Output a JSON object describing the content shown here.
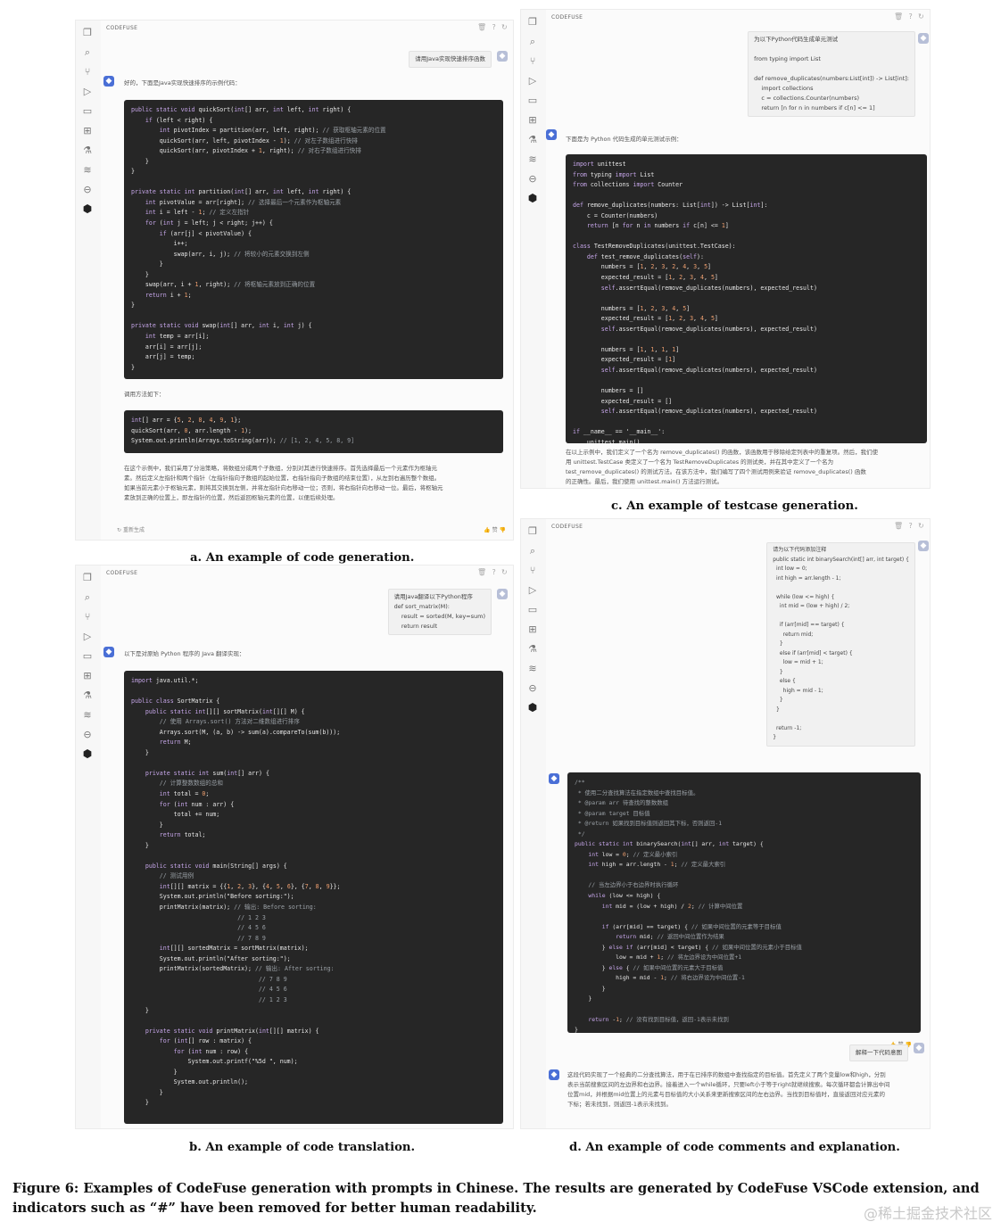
{
  "brand": "CODEFUSE",
  "icons": [
    "copy-icon",
    "search-icon",
    "source-control-icon",
    "run-debug-icon",
    "remote-icon",
    "extensions-icon",
    "flask-icon",
    "docker-icon",
    "minus-circle-icon",
    "codefuse-icon"
  ],
  "panel_a": {
    "prompt": "请用Java实现快速排序函数",
    "intro": "好的，下面是Java实现快速排序的示例代码：",
    "code": [
      "public static void quickSort(int[] arr, int left, int right) {",
      "    if (left < right) {",
      "        int pivotIndex = partition(arr, left, right); // 获取枢轴元素的位置",
      "        quickSort(arr, left, pivotIndex - 1); // 对左子数组进行快排",
      "        quickSort(arr, pivotIndex + 1, right); // 对右子数组进行快排",
      "    }",
      "}",
      "",
      "private static int partition(int[] arr, int left, int right) {",
      "    int pivotValue = arr[right]; // 选择最后一个元素作为枢轴元素",
      "    int i = left - 1; // 定义左指针",
      "    for (int j = left; j < right; j++) {",
      "        if (arr[j] < pivotValue) {",
      "            i++;",
      "            swap(arr, i, j); // 将较小的元素交换到左侧",
      "        }",
      "    }",
      "    swap(arr, i + 1, right); // 将枢轴元素放到正确的位置",
      "    return i + 1;",
      "}",
      "",
      "private static void swap(int[] arr, int i, int j) {",
      "    int temp = arr[i];",
      "    arr[i] = arr[j];",
      "    arr[j] = temp;",
      "}"
    ],
    "usage_label": "调用方法如下：",
    "usage_code": [
      "int[] arr = {5, 2, 8, 4, 9, 1};",
      "quickSort(arr, 0, arr.length - 1);",
      "System.out.println(Arrays.toString(arr)); // [1, 2, 4, 5, 8, 9]"
    ],
    "explain": [
      "在这个示例中，我们采用了分治策略，将数组分成两个子数组，分别对其进行快速排序。首先选择最后一个元素作为枢轴元",
      "素。然后定义左指针和两个指针（左指针指向子数组的起始位置，右指针指向子数组的结束位置），从左到右遍历整个数组。",
      "如果当前元素小于枢轴元素，则将其交换到左侧，并将左指针向右移动一位；否则，将右指针向右移动一位。最后，将枢轴元",
      "素放到正确的位置上，即左指针的位置，然后返回枢轴元素的位置，以便后续处理。"
    ],
    "regenerate": "重新生成",
    "like": "赞",
    "caption": "a. An example of code generation."
  },
  "panel_b": {
    "prompt": "请用Java翻译以下Python程序\ndef sort_matrix(M):\n    result = sorted(M, key=sum)\n    return result",
    "intro": "以下是对原始 Python 程序的 Java 翻译实现：",
    "code": [
      "import java.util.*;",
      "",
      "public class SortMatrix {",
      "    public static int[][] sortMatrix(int[][] M) {",
      "        // 使用 Arrays.sort() 方法对二维数组进行排序",
      "        Arrays.sort(M, (a, b) -> sum(a).compareTo(sum(b)));",
      "        return M;",
      "    }",
      "",
      "    private static int sum(int[] arr) {",
      "        // 计算整数数组的总和",
      "        int total = 0;",
      "        for (int num : arr) {",
      "            total += num;",
      "        }",
      "        return total;",
      "    }",
      "",
      "    public static void main(String[] args) {",
      "        // 测试用例",
      "        int[][] matrix = {{1, 2, 3}, {4, 5, 6}, {7, 8, 9}};",
      "        System.out.println(\"Before sorting:\");",
      "        printMatrix(matrix); // 输出: Before sorting:",
      "                              // 1 2 3",
      "                              // 4 5 6",
      "                              // 7 8 9",
      "        int[][] sortedMatrix = sortMatrix(matrix);",
      "        System.out.println(\"After sorting:\");",
      "        printMatrix(sortedMatrix); // 输出: After sorting:",
      "                                    // 7 8 9",
      "                                    // 4 5 6",
      "                                    // 1 2 3",
      "    }",
      "",
      "    private static void printMatrix(int[][] matrix) {",
      "        for (int[] row : matrix) {",
      "            for (int num : row) {",
      "                System.out.printf(\"%5d \", num);",
      "            }",
      "            System.out.println();",
      "        }",
      "    }"
    ],
    "caption": "b. An example of code translation."
  },
  "panel_c": {
    "prompt": "为以下Python代码生成单元测试\n\nfrom typing import List\n\ndef remove_duplicates(numbers:List[int]) -> List[int]:\n    import collections\n    c = collections.Counter(numbers)\n    return [n for n in numbers if c[n] <= 1]",
    "intro": "下面是为 Python 代码生成的单元测试示例：",
    "code": [
      "import unittest",
      "from typing import List",
      "from collections import Counter",
      "",
      "def remove_duplicates(numbers: List[int]) -> List[int]:",
      "    c = Counter(numbers)",
      "    return [n for n in numbers if c[n] <= 1]",
      "",
      "class TestRemoveDuplicates(unittest.TestCase):",
      "    def test_remove_duplicates(self):",
      "        numbers = [1, 2, 3, 2, 4, 3, 5]",
      "        expected_result = [1, 2, 3, 4, 5]",
      "        self.assertEqual(remove_duplicates(numbers), expected_result)",
      "",
      "        numbers = [1, 2, 3, 4, 5]",
      "        expected_result = [1, 2, 3, 4, 5]",
      "        self.assertEqual(remove_duplicates(numbers), expected_result)",
      "",
      "        numbers = [1, 1, 1, 1]",
      "        expected_result = [1]",
      "        self.assertEqual(remove_duplicates(numbers), expected_result)",
      "",
      "        numbers = []",
      "        expected_result = []",
      "        self.assertEqual(remove_duplicates(numbers), expected_result)",
      "",
      "if __name__ == '__main__':",
      "    unittest.main()"
    ],
    "explain": [
      "在以上示例中，我们定义了一个名为 remove_duplicates() 的函数，该函数用于移除给定列表中的重复项。然后，我们使",
      "用 unittest.TestCase 类定义了一个名为 TestRemoveDuplicates 的测试类，并在其中定义了一个名为",
      "test_remove_duplicates() 的测试方法。在该方法中，我们编写了四个测试用例来验证 remove_duplicates() 函数",
      "的正确性。最后，我们使用 unittest.main() 方法运行测试。"
    ],
    "caption": "c. An example of testcase generation."
  },
  "panel_d": {
    "prompt": "请为以下代码添加注释\npublic static int binarySearch(int[] arr, int target) {\n  int low = 0;\n  int high = arr.length - 1;\n\n  while (low <= high) {\n    int mid = (low + high) / 2;\n\n    if (arr[mid] == target) {\n      return mid;\n    }\n    else if (arr[mid] < target) {\n      low = mid + 1;\n    }\n    else {\n      high = mid - 1;\n    }\n  }\n\n  return -1;\n}",
    "code": [
      "/**",
      " * 使用二分查找算法在指定数组中查找目标值。",
      " * @param arr 待查找的整数数组",
      " * @param target 目标值",
      " * @return 如果找到目标值则返回其下标，否则返回-1",
      " */",
      "public static int binarySearch(int[] arr, int target) {",
      "    int low = 0; // 定义最小索引",
      "    int high = arr.length - 1; // 定义最大索引",
      "",
      "    // 当左边界小于右边界时执行循环",
      "    while (low <= high) {",
      "        int mid = (low + high) / 2; // 计算中间位置",
      "",
      "        if (arr[mid] == target) { // 如果中间位置的元素等于目标值",
      "            return mid; // 返回中间位置作为结果",
      "        } else if (arr[mid] < target) { // 如果中间位置的元素小于目标值",
      "            low = mid + 1; // 将左边界设为中间位置+1",
      "        } else { // 如果中间位置的元素大于目标值",
      "            high = mid - 1; // 将右边界设为中间位置-1",
      "        }",
      "    }",
      "",
      "    return -1; // 没有找到目标值，返回-1表示未找到",
      "}"
    ],
    "explain_prompt": "解释一下代码意图",
    "explain": [
      "这段代码实现了一个经典的二分查找算法，用于在已排序的数组中查找指定的目标值。首先定义了两个变量low和high，分别",
      "表示当前搜索区间的左边界和右边界。接着进入一个while循环，只要left小于等于right就继续搜索。每次循环都会计算出中间",
      "位置mid，并根据mid位置上的元素与目标值的大小关系来更新搜索区间的左右边界。当找到目标值时，直接返回对应元素的",
      "下标；若未找到，则返回-1表示未找到。"
    ],
    "caption": "d. An example of code comments and explanation."
  },
  "figure_caption": "Figure 6: Examples of CodeFuse generation with prompts in Chinese. The results are generated by CodeFuse VSCode extension, and indicators such as “#” have been removed for better human readability.",
  "watermark": "@稀土掘金技术社区"
}
